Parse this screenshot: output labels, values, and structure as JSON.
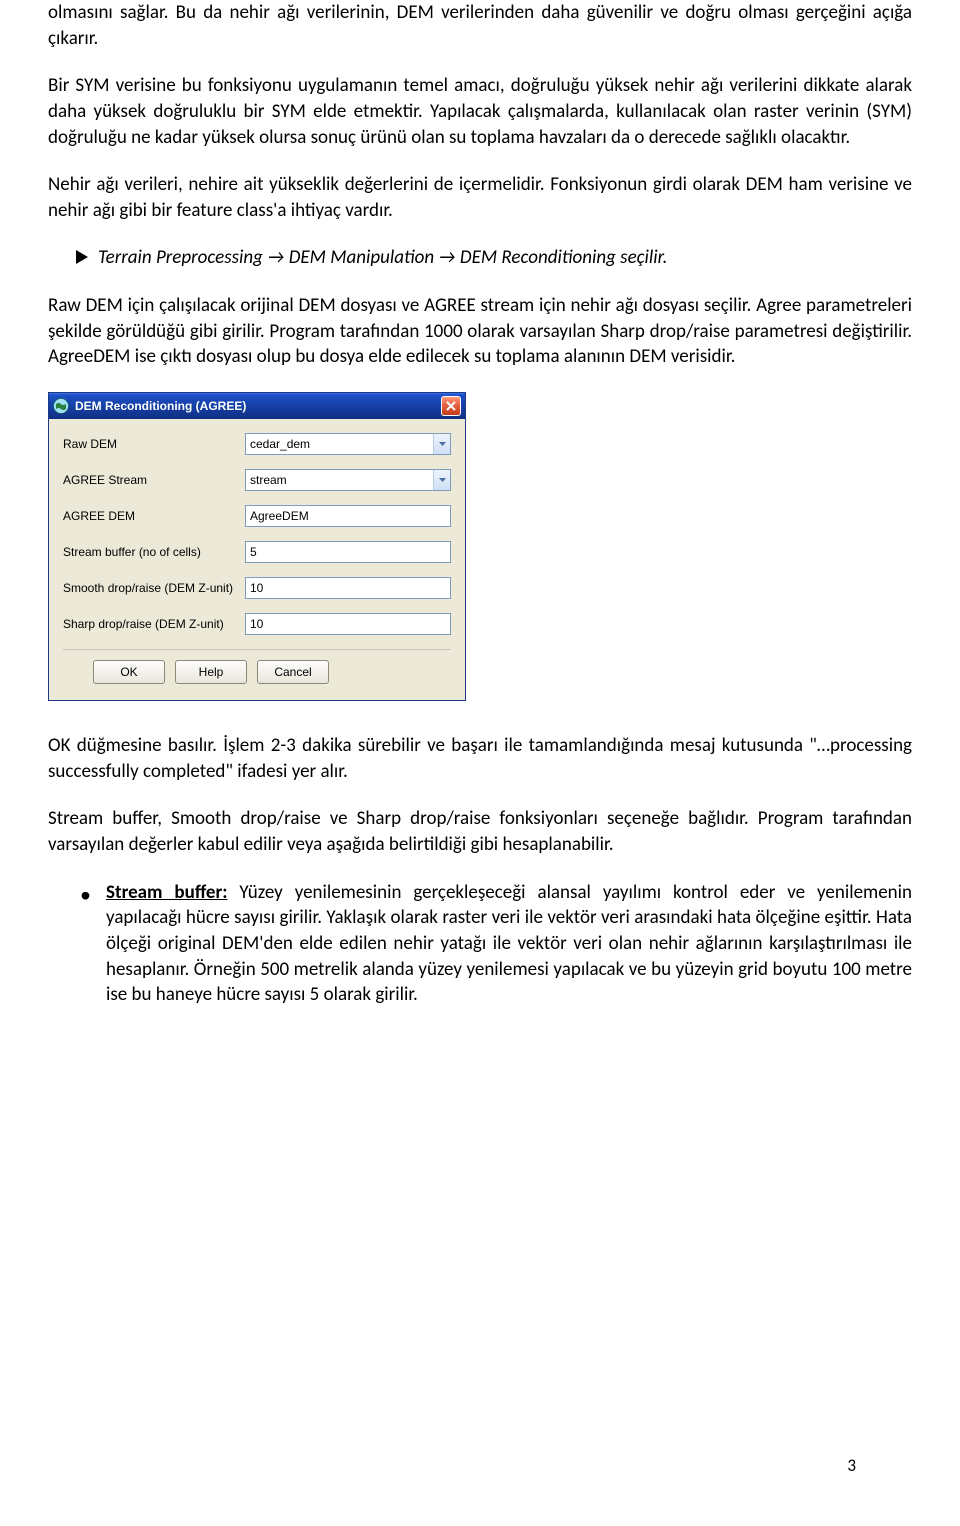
{
  "paragraphs": {
    "p1": "olmasını sağlar. Bu da nehir ağı verilerinin, DEM verilerinden daha güvenilir ve doğru olması gerçeğini açığa çıkarır.",
    "p2": "Bir SYM verisine bu fonksiyonu uygulamanın temel amacı, doğruluğu yüksek nehir ağı verilerini dikkate alarak daha yüksek doğruluklu bir SYM elde etmektir. Yapılacak çalışmalarda, kullanılacak olan raster verinin (SYM) doğruluğu ne kadar yüksek olursa sonuç ürünü olan su toplama havzaları da o derecede sağlıklı olacaktır.",
    "p3": "Nehir ağı verileri, nehire ait yükseklik değerlerini de içermelidir. Fonksiyonun girdi olarak DEM ham verisine ve nehir ağı gibi bir feature class'a ihtiyaç vardır.",
    "menu": "Terrain Preprocessing → DEM Manipulation → DEM Reconditioning seçilir.",
    "p4": "Raw DEM için çalışılacak orijinal DEM dosyası ve AGREE stream için nehir ağı dosyası seçilir. Agree parametreleri şekilde görüldüğü gibi girilir. Program tarafından 1000 olarak varsayılan Sharp drop/raise parametresi değiştirilir. AgreeDEM ise çıktı dosyası olup bu dosya elde edilecek su toplama alanının DEM verisidir.",
    "p5": "OK düğmesine basılır. İşlem 2-3 dakika sürebilir ve başarı ile tamamlandığında mesaj kutusunda \"…processing successfully completed\" ifadesi yer alır.",
    "p6": "Stream buffer, Smooth drop/raise ve Sharp drop/raise fonksiyonları seçeneğe bağlıdır. Program tarafından varsayılan değerler kabul edilir veya aşağıda belirtildiği gibi hesaplanabilir.",
    "bullet1_label": "Stream buffer:",
    "bullet1_text": " Yüzey yenilemesinin gerçekleşeceği alansal yayılımı kontrol eder ve yenilemenin yapılacağı hücre sayısı girilir. Yaklaşık olarak raster veri ile vektör veri arasındaki hata ölçeğine eşittir. Hata ölçeği original DEM'den elde edilen nehir yatağı ile vektör veri olan nehir ağlarının karşılaştırılması ile hesaplanır. Örneğin 500 metrelik alanda yüzey yenilemesi yapılacak ve bu yüzeyin grid boyutu 100 metre ise bu haneye hücre sayısı 5 olarak girilir."
  },
  "dialog": {
    "title": "DEM Reconditioning (AGREE)",
    "rows": {
      "raw_dem": {
        "label": "Raw DEM",
        "value": "cedar_dem"
      },
      "agree_stream": {
        "label": "AGREE Stream",
        "value": "stream"
      },
      "agree_dem": {
        "label": "AGREE DEM",
        "value": "AgreeDEM"
      },
      "stream_buffer": {
        "label": "Stream buffer (no of cells)",
        "value": "5"
      },
      "smooth_drop": {
        "label": "Smooth drop/raise (DEM Z-unit)",
        "value": "10"
      },
      "sharp_drop": {
        "label": "Sharp drop/raise (DEM Z-unit)",
        "value": "10"
      }
    },
    "buttons": {
      "ok": "OK",
      "help": "Help",
      "cancel": "Cancel"
    }
  },
  "page_number": "3"
}
